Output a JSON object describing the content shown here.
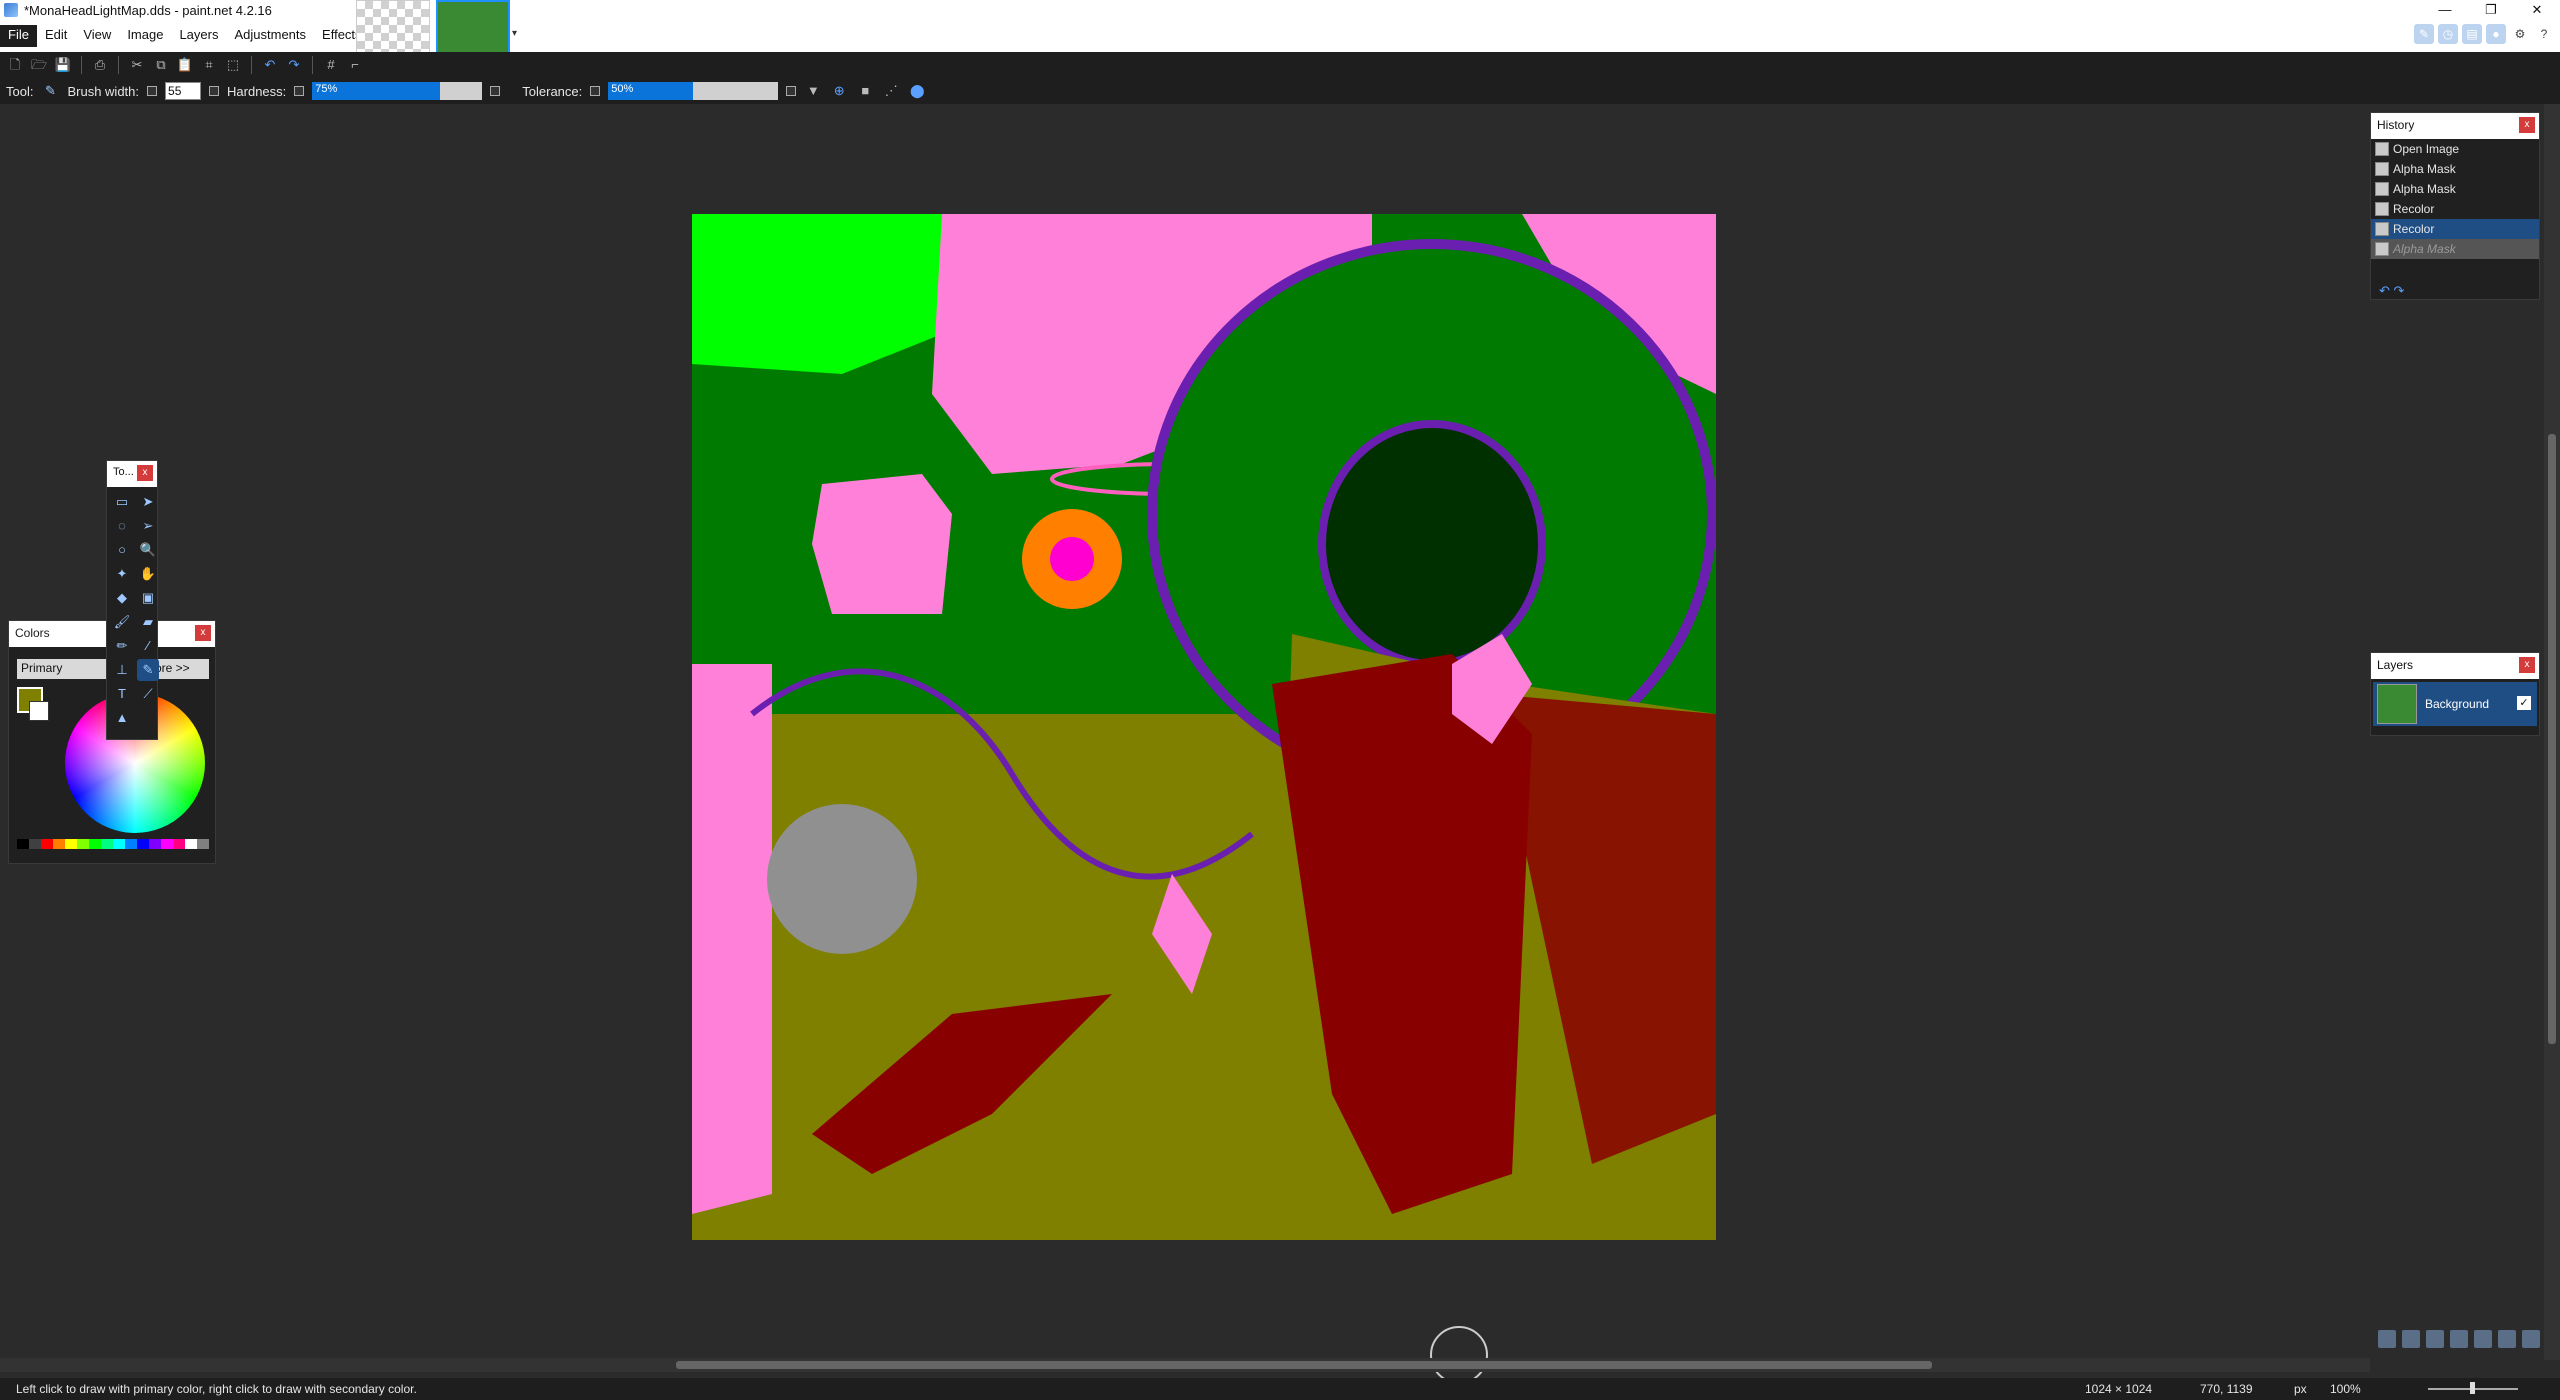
{
  "window": {
    "title": "*MonaHeadLightMap.dds - paint.net 4.2.16",
    "controls": {
      "minimize": "—",
      "maximize": "❐",
      "close": "✕"
    }
  },
  "menu": [
    "File",
    "Edit",
    "View",
    "Image",
    "Layers",
    "Adjustments",
    "Effects"
  ],
  "toolbar": {
    "tool_label": "Tool:",
    "brush_width_label": "Brush width:",
    "brush_width_value": "55",
    "hardness_label": "Hardness:",
    "hardness_value": "75%",
    "hardness_fraction": 0.75,
    "tolerance_label": "Tolerance:",
    "tolerance_value": "50%",
    "tolerance_fraction": 0.5
  },
  "history": {
    "title": "History",
    "close": "x",
    "items": [
      {
        "label": "Open Image",
        "state": "normal"
      },
      {
        "label": "Alpha Mask",
        "state": "normal"
      },
      {
        "label": "Alpha Mask",
        "state": "normal"
      },
      {
        "label": "Recolor",
        "state": "normal"
      },
      {
        "label": "Recolor",
        "state": "selected"
      },
      {
        "label": "Alpha Mask",
        "state": "undone"
      }
    ]
  },
  "layers": {
    "title": "Layers",
    "close": "x",
    "items": [
      {
        "name": "Background",
        "visible": true
      }
    ]
  },
  "tools_panel": {
    "title": "To...",
    "close": "x"
  },
  "colors": {
    "title": "Colors",
    "close": "x",
    "primary_label": "Primary",
    "more_label": "ore >>",
    "primary_color": "#7f7f00",
    "secondary_color": "#ffffff"
  },
  "status": {
    "hint": "Left click to draw with primary color, right click to draw with secondary color.",
    "image_size": "1024 × 1024",
    "cursor_coords": "770, 1139",
    "units": "px",
    "zoom": "100%"
  },
  "colors_accent": {
    "selection": "#1f4e85",
    "canvas_bg": "#2b2b2b"
  }
}
